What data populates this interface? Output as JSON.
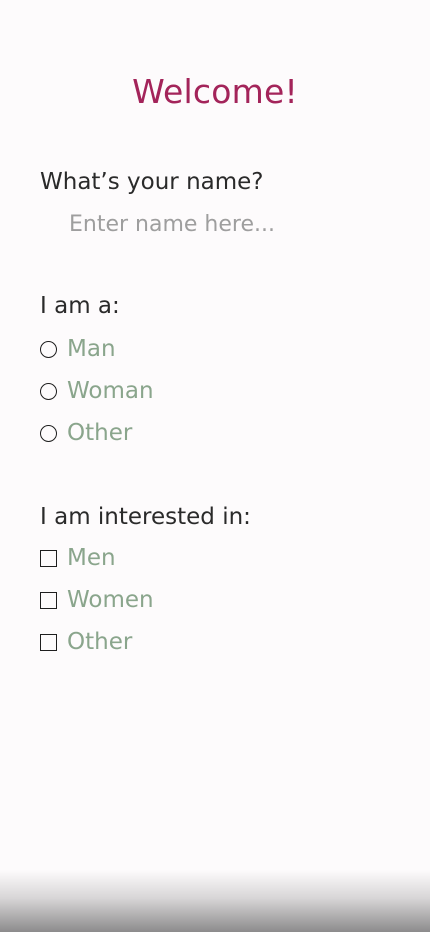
{
  "colors": {
    "title": "#a3245a",
    "option_text": "#8aa58c",
    "label_text": "#2a2a2a",
    "placeholder": "#9e9e9e",
    "background": "#fdfbfc"
  },
  "header": {
    "title": "Welcome!"
  },
  "name_section": {
    "label": "What’s your name?",
    "input_value": "",
    "input_placeholder": "Enter name here..."
  },
  "gender_section": {
    "label": "I am a:",
    "control": "radio",
    "options": [
      {
        "label": "Man",
        "selected": false
      },
      {
        "label": "Woman",
        "selected": false
      },
      {
        "label": "Other",
        "selected": false
      }
    ]
  },
  "interest_section": {
    "label": "I am interested in:",
    "control": "checkbox",
    "options": [
      {
        "label": "Men",
        "checked": false
      },
      {
        "label": "Women",
        "checked": false
      },
      {
        "label": "Other",
        "checked": false
      }
    ]
  }
}
